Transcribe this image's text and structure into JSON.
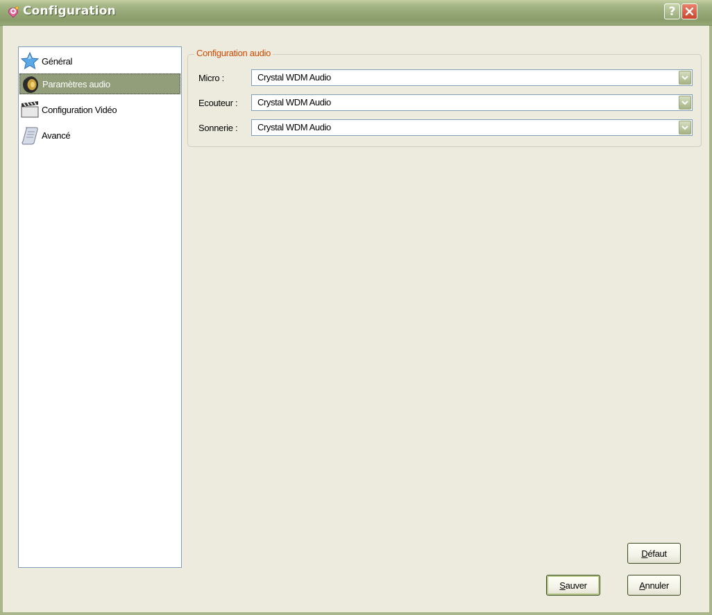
{
  "window": {
    "title": "Configuration",
    "help_glyph": "?",
    "close_icon": "close-icon"
  },
  "nav": {
    "items": [
      {
        "label": "Général",
        "icon": "star-icon",
        "selected": false
      },
      {
        "label": "Paramètres audio",
        "icon": "speaker-icon",
        "selected": true
      },
      {
        "label": "Configuration Vidéo",
        "icon": "clapperboard-icon",
        "selected": false
      },
      {
        "label": "Avancé",
        "icon": "scroll-icon",
        "selected": false
      }
    ]
  },
  "audio": {
    "group_title": "Configuration audio",
    "fields": [
      {
        "label": "Micro :",
        "value": "Crystal WDM Audio"
      },
      {
        "label": "Ecouteur :",
        "value": "Crystal WDM Audio"
      },
      {
        "label": "Sonnerie :",
        "value": "Crystal WDM Audio"
      }
    ]
  },
  "buttons": {
    "default_first": "D",
    "default_rest": "éfaut",
    "save_first": "S",
    "save_rest": "auver",
    "cancel_first": "A",
    "cancel_rest": "nnuler"
  },
  "colors": {
    "title_gradient": "#93a673",
    "selection": "#929d79",
    "group_title": "#d04a02",
    "window_bg": "#ecebde"
  }
}
